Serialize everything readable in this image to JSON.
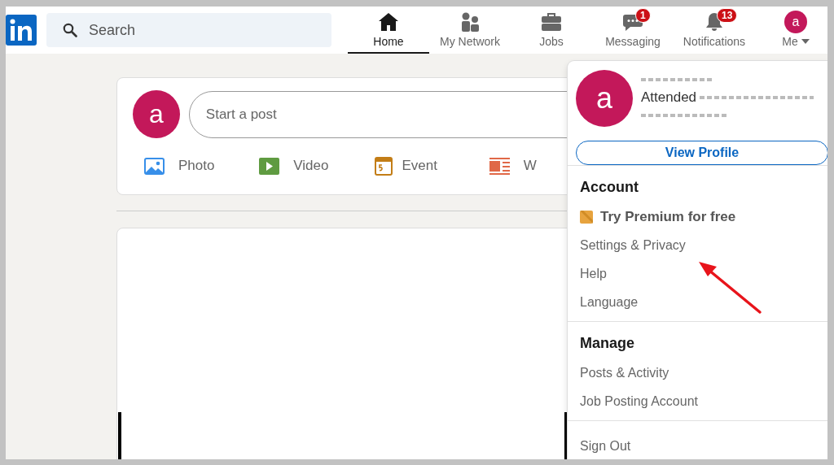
{
  "search": {
    "placeholder": "Search"
  },
  "nav": [
    {
      "label": "Home",
      "selected": true,
      "kind": "home"
    },
    {
      "label": "My Network",
      "selected": false,
      "kind": "network"
    },
    {
      "label": "Jobs",
      "selected": false,
      "kind": "jobs"
    },
    {
      "label": "Messaging",
      "selected": false,
      "kind": "messaging",
      "badge": "1"
    },
    {
      "label": "Notifications",
      "selected": false,
      "kind": "notifications",
      "badge": "13"
    },
    {
      "label": "Me",
      "selected": false,
      "kind": "me",
      "avatar": "a"
    }
  ],
  "composer": {
    "avatar": "a",
    "placeholder": "Start a post",
    "actions": [
      {
        "label": "Photo",
        "kind": "photo"
      },
      {
        "label": "Video",
        "kind": "video"
      },
      {
        "label": "Event",
        "kind": "event"
      },
      {
        "label": "W",
        "kind": "article"
      }
    ]
  },
  "profile_menu": {
    "avatar": "a",
    "headline": "Attended",
    "view_profile": "View Profile",
    "sections": [
      {
        "title": "Account",
        "items": [
          {
            "label": "Try Premium for free",
            "kind": "premium"
          },
          {
            "label": "Settings & Privacy",
            "kind": "link"
          },
          {
            "label": "Help",
            "kind": "link"
          },
          {
            "label": "Language",
            "kind": "link"
          }
        ]
      },
      {
        "title": "Manage",
        "items": [
          {
            "label": "Posts & Activity",
            "kind": "link"
          },
          {
            "label": "Job Posting Account",
            "kind": "link"
          }
        ]
      },
      {
        "items": [
          {
            "label": "Sign Out",
            "kind": "link"
          }
        ]
      }
    ]
  },
  "annotation_arrow": true
}
